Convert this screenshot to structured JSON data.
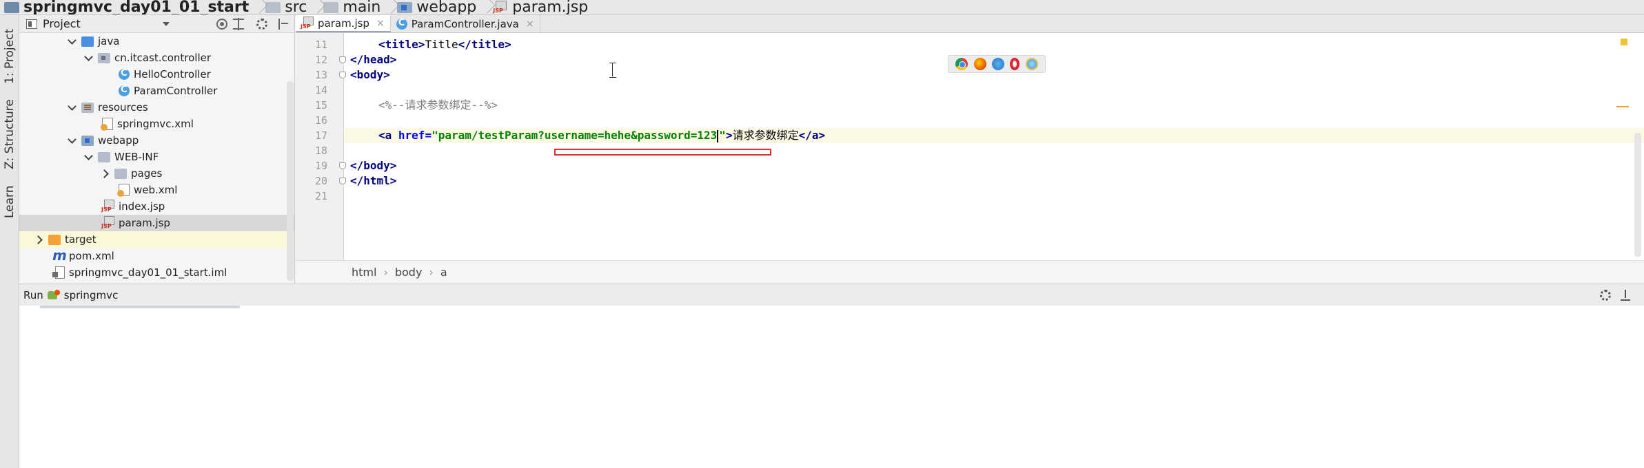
{
  "breadcrumbs": [
    {
      "label": "springmvc_day01_01_start",
      "icon": "project-icon"
    },
    {
      "label": "src",
      "icon": "folder-icon"
    },
    {
      "label": "main",
      "icon": "folder-icon"
    },
    {
      "label": "webapp",
      "icon": "web-folder-icon"
    },
    {
      "label": "param.jsp",
      "icon": "jsp-file-icon"
    }
  ],
  "tool_strip": {
    "project": "1: Project",
    "structure": "Z: Structure",
    "learn": "Learn"
  },
  "project_panel": {
    "title": "Project",
    "tree": [
      {
        "label": "java",
        "arrow": "down",
        "icon": "folder-blue"
      },
      {
        "label": "cn.itcast.controller",
        "arrow": "down",
        "icon": "package"
      },
      {
        "label": "HelloController",
        "arrow": "none",
        "icon": "class"
      },
      {
        "label": "ParamController",
        "arrow": "none",
        "icon": "class"
      },
      {
        "label": "resources",
        "arrow": "down",
        "icon": "resources"
      },
      {
        "label": "springmvc.xml",
        "arrow": "none",
        "icon": "xml"
      },
      {
        "label": "webapp",
        "arrow": "down",
        "icon": "webapp"
      },
      {
        "label": "WEB-INF",
        "arrow": "down",
        "icon": "folder"
      },
      {
        "label": "pages",
        "arrow": "right",
        "icon": "folder"
      },
      {
        "label": "web.xml",
        "arrow": "none",
        "icon": "xml"
      },
      {
        "label": "index.jsp",
        "arrow": "none",
        "icon": "jsp"
      },
      {
        "label": "param.jsp",
        "arrow": "none",
        "icon": "jsp"
      },
      {
        "label": "target",
        "arrow": "right",
        "icon": "folder-orange"
      },
      {
        "label": "pom.xml",
        "arrow": "none",
        "icon": "maven"
      },
      {
        "label": "springmvc_day01_01_start.iml",
        "arrow": "none",
        "icon": "iml"
      }
    ]
  },
  "editor_tabs": [
    {
      "label": "param.jsp",
      "close": "×",
      "active": true,
      "icon": "jsp-file-icon"
    },
    {
      "label": "ParamController.java",
      "close": "×",
      "active": false,
      "icon": "class-icon"
    }
  ],
  "code": {
    "line_numbers": [
      "11",
      "12",
      "13",
      "14",
      "15",
      "16",
      "17",
      "18",
      "19",
      "20",
      "21"
    ],
    "line11": {
      "open": "<title>",
      "text": "Title",
      "close": "</title>"
    },
    "line12": {
      "close": "</head>"
    },
    "line13": {
      "open": "<body>"
    },
    "line15": {
      "comment": "<%--请求参数绑定--%>"
    },
    "line17": {
      "open": "<a",
      "attr": "href=",
      "value_before_caret": "\"param/testParam?username=hehe&password=123",
      "value_after_caret": "\"",
      "gt": ">",
      "text": "请求参数绑定",
      "close": "</a>"
    },
    "line19": {
      "close": "</body>"
    },
    "line20": {
      "close": "</html>"
    }
  },
  "editor_breadcrumbs": [
    "html",
    "body",
    "a"
  ],
  "run_bar": {
    "label": "Run",
    "config": "springmvc"
  },
  "browser_icons": [
    "chrome-icon",
    "firefox-icon",
    "safari-icon",
    "opera-icon",
    "ie-icon"
  ]
}
